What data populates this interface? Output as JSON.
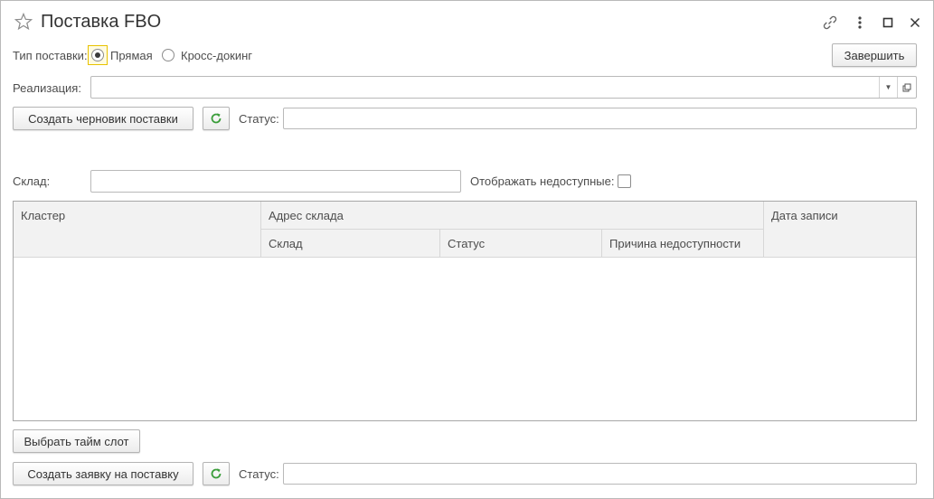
{
  "window": {
    "title": "Поставка FBO",
    "icons": [
      "star-icon",
      "link-icon",
      "more-icon",
      "maximize-icon",
      "close-icon"
    ]
  },
  "supply_type": {
    "label": "Тип поставки:",
    "options": [
      {
        "label": "Прямая",
        "selected": true
      },
      {
        "label": "Кросс-докинг",
        "selected": false
      }
    ]
  },
  "finish_button": "Завершить",
  "realization": {
    "label": "Реализация:",
    "value": ""
  },
  "draft": {
    "button": "Создать черновик поставки",
    "status_label": "Статус:",
    "status_value": ""
  },
  "warehouse": {
    "label": "Склад:",
    "value": "",
    "show_unavailable_label": "Отображать недоступные:",
    "show_unavailable_checked": false
  },
  "table": {
    "columns": {
      "cluster": "Кластер",
      "address_group": "Адрес склада",
      "warehouse": "Склад",
      "status": "Статус",
      "reason": "Причина недоступности",
      "record_date": "Дата записи"
    },
    "rows": []
  },
  "timeslot_button": "Выбрать тайм слот",
  "request": {
    "button": "Создать заявку на поставку",
    "status_label": "Статус:",
    "status_value": ""
  },
  "colors": {
    "accent_refresh": "#3a9d3a",
    "focus_highlight": "#e8c200"
  }
}
